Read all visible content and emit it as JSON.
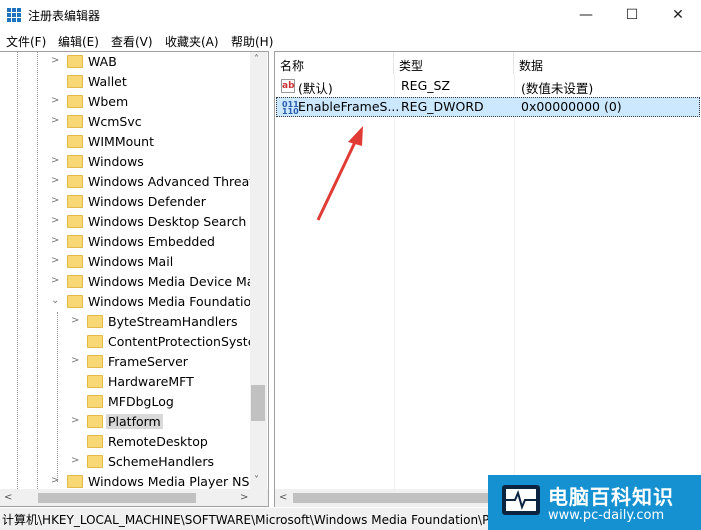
{
  "window": {
    "title": "注册表编辑器",
    "minimize": "—",
    "maximize": "☐",
    "close": "✕"
  },
  "menu": [
    "文件(F)",
    "编辑(E)",
    "查看(V)",
    "收藏夹(A)",
    "帮助(H)"
  ],
  "tree": [
    {
      "label": "WAB",
      "level": 1,
      "chevron": ">"
    },
    {
      "label": "Wallet",
      "level": 1,
      "chevron": ""
    },
    {
      "label": "Wbem",
      "level": 1,
      "chevron": ">"
    },
    {
      "label": "WcmSvc",
      "level": 1,
      "chevron": ">"
    },
    {
      "label": "WIMMount",
      "level": 1,
      "chevron": ""
    },
    {
      "label": "Windows",
      "level": 1,
      "chevron": ">"
    },
    {
      "label": "Windows Advanced Threat P",
      "level": 1,
      "chevron": ">"
    },
    {
      "label": "Windows Defender",
      "level": 1,
      "chevron": ">"
    },
    {
      "label": "Windows Desktop Search",
      "level": 1,
      "chevron": ">"
    },
    {
      "label": "Windows Embedded",
      "level": 1,
      "chevron": ">"
    },
    {
      "label": "Windows Mail",
      "level": 1,
      "chevron": ">"
    },
    {
      "label": "Windows Media Device Mar",
      "level": 1,
      "chevron": ">"
    },
    {
      "label": "Windows Media Foundation",
      "level": 1,
      "chevron": "⌄"
    },
    {
      "label": "ByteStreamHandlers",
      "level": 2,
      "chevron": ">"
    },
    {
      "label": "ContentProtectionSystem",
      "level": 2,
      "chevron": ""
    },
    {
      "label": "FrameServer",
      "level": 2,
      "chevron": ">"
    },
    {
      "label": "HardwareMFT",
      "level": 2,
      "chevron": ""
    },
    {
      "label": "MFDbgLog",
      "level": 2,
      "chevron": ""
    },
    {
      "label": "Platform",
      "level": 2,
      "chevron": ">",
      "selected": true
    },
    {
      "label": "RemoteDesktop",
      "level": 2,
      "chevron": ""
    },
    {
      "label": "SchemeHandlers",
      "level": 2,
      "chevron": ">"
    },
    {
      "label": "Windows Media Player NSS",
      "level": 1,
      "chevron": ">"
    }
  ],
  "list": {
    "columns": [
      "名称",
      "类型",
      "数据"
    ],
    "rows": [
      {
        "icon": "string-value-icon",
        "name": "(默认)",
        "type": "REG_SZ",
        "data": "(数值未设置)"
      },
      {
        "icon": "binary-value-icon",
        "name": "EnableFrameS...",
        "type": "REG_DWORD",
        "data": "0x00000000 (0)",
        "selected": true
      }
    ]
  },
  "status": "计算机\\HKEY_LOCAL_MACHINE\\SOFTWARE\\Microsoft\\Windows Media Foundation\\Platform",
  "watermark": {
    "title": "电脑百科知识",
    "url": "www.pc-daily.com"
  },
  "colors": {
    "accent": "#1e73be",
    "selection": "#cce8ff",
    "arrow": "#e03b35",
    "watermark": "#1591d2"
  }
}
